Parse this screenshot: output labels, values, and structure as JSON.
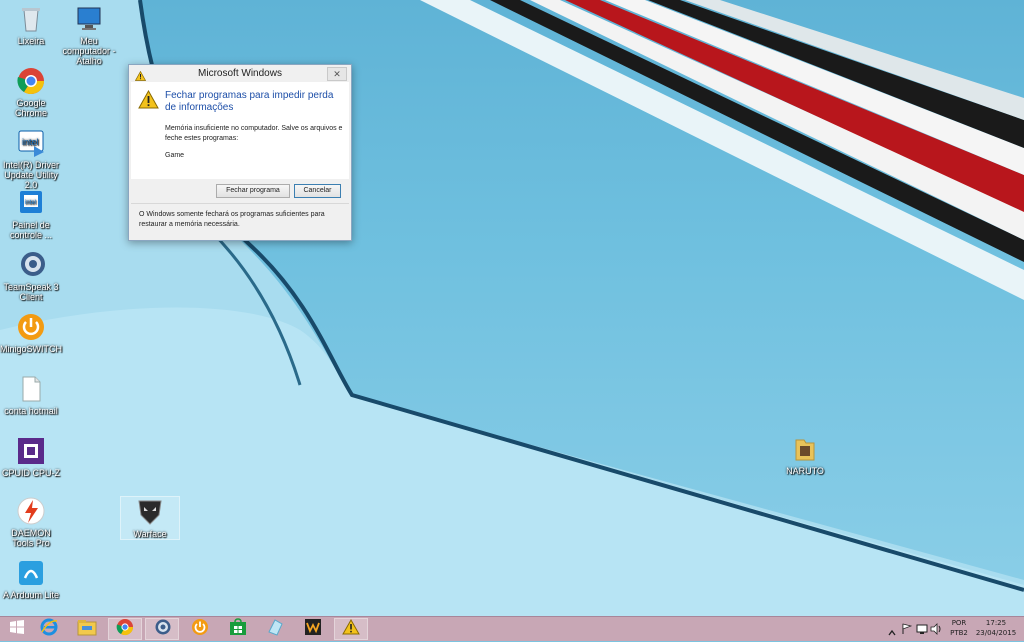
{
  "desktop": {
    "icons": [
      {
        "label": "Lixeira",
        "icon": "recycle-bin-icon"
      },
      {
        "label": "Meu computador - Atalho",
        "icon": "computer-icon"
      },
      {
        "label": "Google Chrome",
        "icon": "chrome-icon"
      },
      {
        "label": "Intel(R) Driver Update Utility 2.0",
        "icon": "intel-driver-icon"
      },
      {
        "label": "Painel de controle ...",
        "icon": "intel-control-panel-icon"
      },
      {
        "label": "TeamSpeak 3 Client",
        "icon": "teamspeak-icon"
      },
      {
        "label": "MinigoSWITCH",
        "icon": "power-icon"
      },
      {
        "label": "conta hotmail",
        "icon": "text-file-icon"
      },
      {
        "label": "CPUID CPU-Z",
        "icon": "cpuz-icon"
      },
      {
        "label": "DAEMON Tools Pro",
        "icon": "daemon-tools-icon"
      },
      {
        "label": "Warface",
        "icon": "warface-icon"
      },
      {
        "label": "A Arduum Lite",
        "icon": "app-icon"
      },
      {
        "label": "NARUTO",
        "icon": "folder-icon"
      }
    ]
  },
  "dialog": {
    "title": "Microsoft Windows",
    "close": "✕",
    "heading": "Fechar programas para impedir perda de informações",
    "message": "Memória insuficiente no computador. Salve os arquivos e feche estes programas:",
    "program": "Game",
    "buttons": {
      "close_program": "Fechar programa",
      "cancel": "Cancelar"
    },
    "footer": "O Windows somente fechará os programas suficientes para restaurar a memória necessária."
  },
  "taskbar": {
    "apps": [
      {
        "icon": "start-icon",
        "running": false
      },
      {
        "icon": "internet-explorer-icon",
        "running": false
      },
      {
        "icon": "file-explorer-icon",
        "running": false
      },
      {
        "icon": "chrome-icon",
        "running": true
      },
      {
        "icon": "teamspeak-icon",
        "running": true
      },
      {
        "icon": "power-icon",
        "running": false
      },
      {
        "icon": "store-icon",
        "running": false
      },
      {
        "icon": "app-icon",
        "running": false
      },
      {
        "icon": "w-app-icon",
        "running": false
      },
      {
        "icon": "warning-icon",
        "running": true
      }
    ],
    "tray": {
      "lang_top": "POR",
      "lang_bottom": "PTB2",
      "time": "17:25",
      "date": "23/04/2015"
    }
  },
  "colors": {
    "dialog_heading": "#1e4fa8",
    "taskbar": "#c8a7b5"
  }
}
